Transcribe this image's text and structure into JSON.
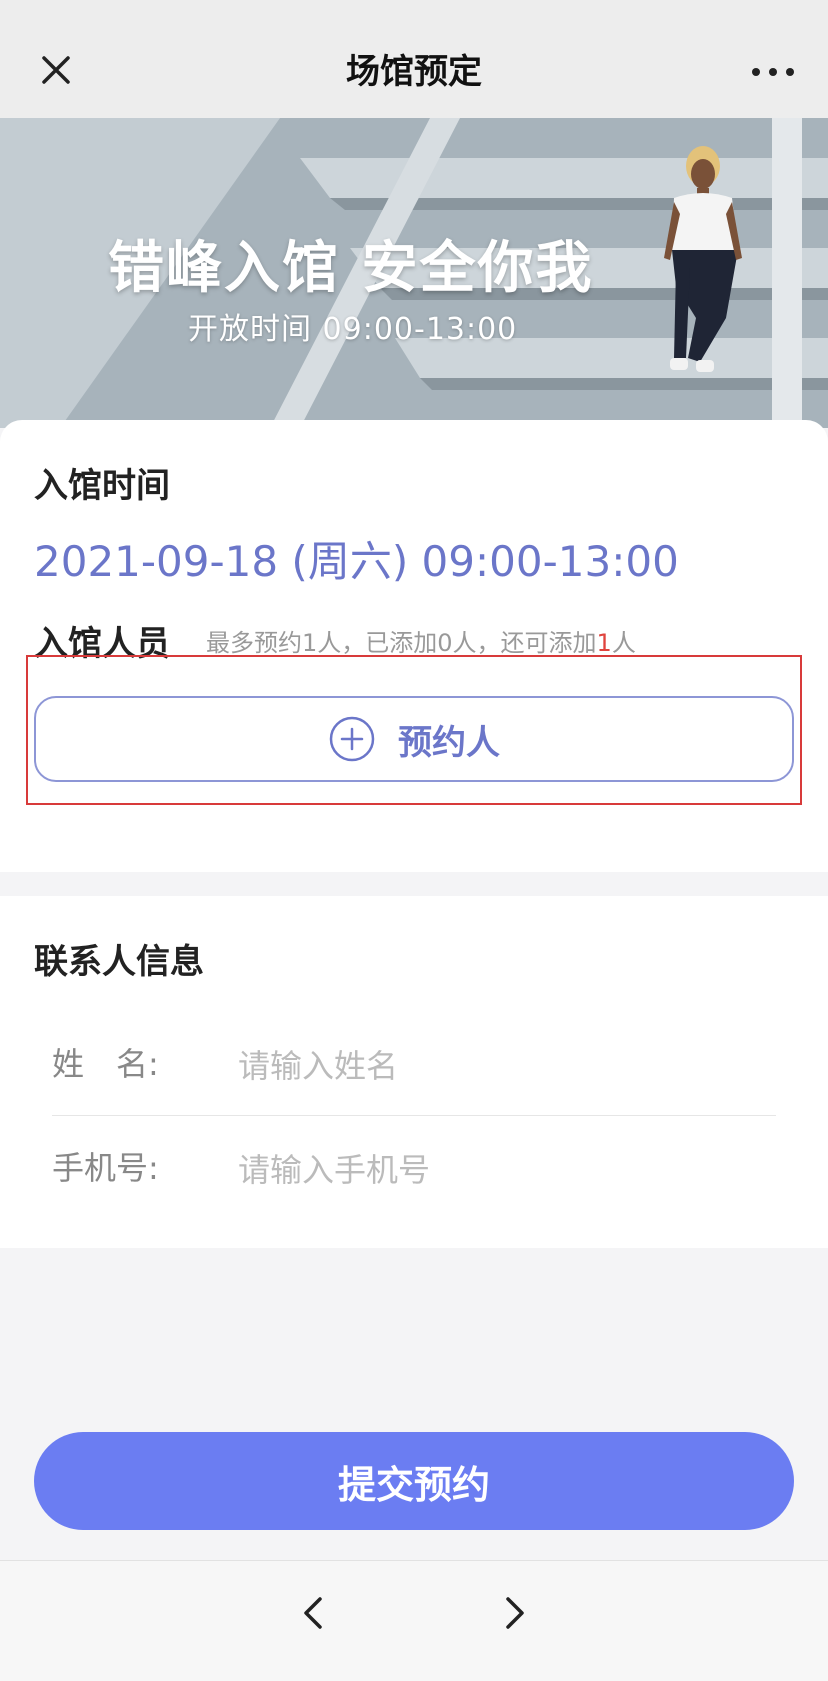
{
  "navbar": {
    "title": "场馆预定",
    "close_icon": "close-icon",
    "more_icon": "more-icon"
  },
  "banner": {
    "headline": "错峰入馆  安全你我",
    "subline": "开放时间 09:00-13:00"
  },
  "booking": {
    "time_label": "入馆时间",
    "time_value": "2021-09-18 (周六) 09:00-13:00",
    "people_label": "入馆人员",
    "people_hint_prefix": "最多预约1人，已添加0人，还可添加",
    "people_hint_remaining": "1",
    "people_hint_suffix": "人",
    "add_button_label": "预约人",
    "add_icon": "plus-circle-icon"
  },
  "contact": {
    "title": "联系人信息",
    "name_label": "姓　名:",
    "name_placeholder": "请输入姓名",
    "phone_label": "手机号:",
    "phone_placeholder": "请输入手机号"
  },
  "submit_label": "提交预约",
  "bottom_nav": {
    "back_icon": "chevron-left-icon",
    "forward_icon": "chevron-right-icon"
  },
  "colors": {
    "accent": "#6b7df2",
    "accent_text": "#6b76c9",
    "highlight": "#d83a3a"
  }
}
